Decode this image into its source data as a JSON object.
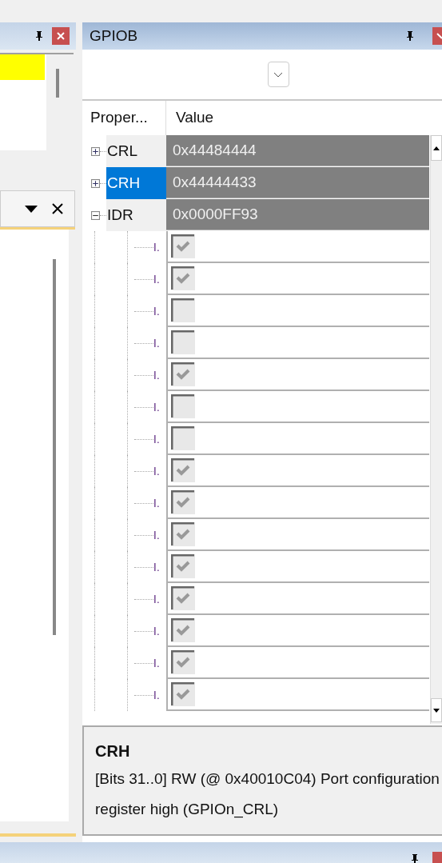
{
  "panel": {
    "title": "GPIOB"
  },
  "table": {
    "columns": [
      "Proper...",
      "Value"
    ],
    "rows": [
      {
        "name": "CRL",
        "value": "0x44484444",
        "expanded": false,
        "selected": false,
        "children": []
      },
      {
        "name": "CRH",
        "value": "0x44444433",
        "expanded": false,
        "selected": true,
        "children": []
      },
      {
        "name": "IDR",
        "value": "0x0000FF93",
        "expanded": true,
        "selected": false,
        "children": [
          {
            "label": "I.",
            "checked": true
          },
          {
            "label": "I.",
            "checked": true
          },
          {
            "label": "I.",
            "checked": false
          },
          {
            "label": "I.",
            "checked": false
          },
          {
            "label": "I.",
            "checked": true
          },
          {
            "label": "I.",
            "checked": false
          },
          {
            "label": "I.",
            "checked": false
          },
          {
            "label": "I.",
            "checked": true
          },
          {
            "label": "I.",
            "checked": true
          },
          {
            "label": "I.",
            "checked": true
          },
          {
            "label": "I.",
            "checked": true
          },
          {
            "label": "I.",
            "checked": true
          },
          {
            "label": "I.",
            "checked": true
          },
          {
            "label": "I.",
            "checked": true
          },
          {
            "label": "I.",
            "checked": true
          }
        ]
      }
    ]
  },
  "tooltip": {
    "title": "CRH",
    "description": "[Bits 31..0] RW (@ 0x40010C04) Port configuration register high  (GPIOn_CRL)"
  }
}
